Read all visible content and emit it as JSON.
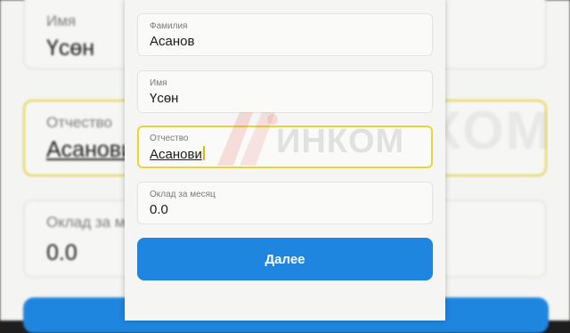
{
  "form": {
    "fields": [
      {
        "label": "Фамилия",
        "value": "Асанов"
      },
      {
        "label": "Имя",
        "value": "Үсөн"
      },
      {
        "label": "Отчество",
        "value": "Асанови"
      },
      {
        "label": "Оклад за месяц",
        "value": "0.0"
      }
    ],
    "next_label": "Далее"
  },
  "watermark": "ИНКОМ",
  "colors": {
    "accent": "#1f86e0",
    "focus_border": "#e5d53a"
  }
}
